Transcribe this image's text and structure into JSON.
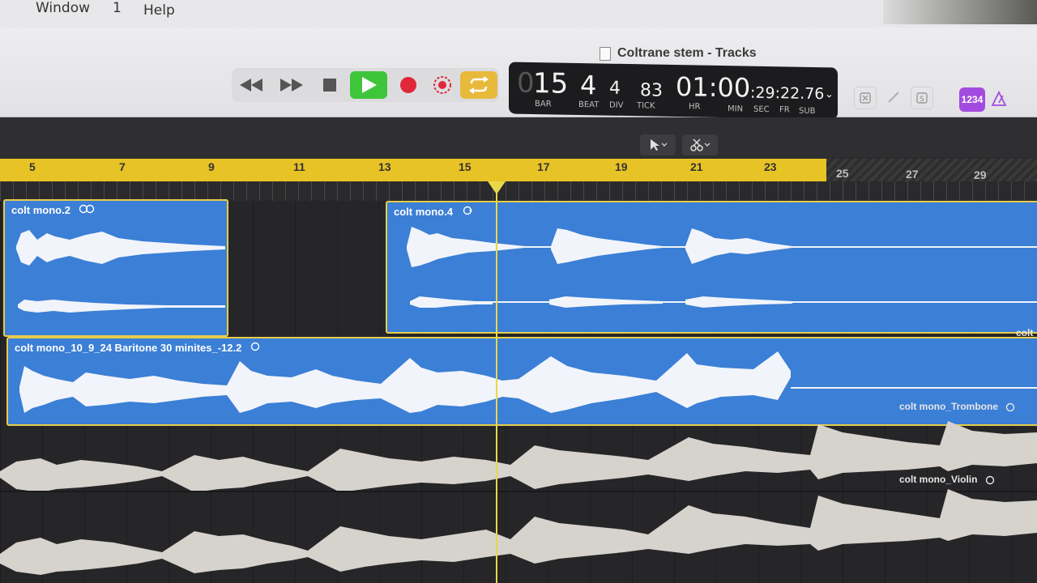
{
  "menubar": {
    "items": [
      "Window",
      "1",
      "Help"
    ]
  },
  "window": {
    "title": "Coltrane stem - Tracks"
  },
  "lcd": {
    "bar": "15",
    "beat": "4",
    "div": "4",
    "tick": "83",
    "time_hr": "01:00",
    "time_rest": ":29:22.76",
    "labels": {
      "bar": "BAR",
      "beat": "BEAT",
      "div": "DIV",
      "tick": "TICK",
      "hr": "HR",
      "min": "MIN",
      "sec": "SEC",
      "fr": "FR",
      "sub": "SUB"
    }
  },
  "count_in_badge": "1234",
  "ruler": {
    "bars": [
      "5",
      "7",
      "9",
      "11",
      "13",
      "15",
      "17",
      "19",
      "21",
      "23",
      "25",
      "27",
      "29"
    ]
  },
  "regions": {
    "r1": {
      "title": "colt mono.2"
    },
    "r2": {
      "title": "colt mono.4"
    },
    "r3": {
      "title": "colt mono_10_9_24 Baritone 30 minites_-12.2"
    },
    "r3_edge": "colt"
  },
  "tracks": {
    "trombone": "colt mono_Trombone",
    "violin": "colt mono_Violin"
  },
  "colors": {
    "region_blue": "#3b7fd6",
    "ruler_yellow": "#e8c325",
    "play_green": "#3fc53a",
    "record_red": "#e0283a",
    "cycle_yellow": "#e8b93a",
    "count_in_purple": "#a34be0"
  },
  "icons": [
    "rewind-icon",
    "fast-forward-icon",
    "stop-icon",
    "play-icon",
    "record-icon",
    "capture-record-icon",
    "cycle-icon",
    "pointer-tool-icon",
    "scissors-tool-icon",
    "loop-icon"
  ]
}
